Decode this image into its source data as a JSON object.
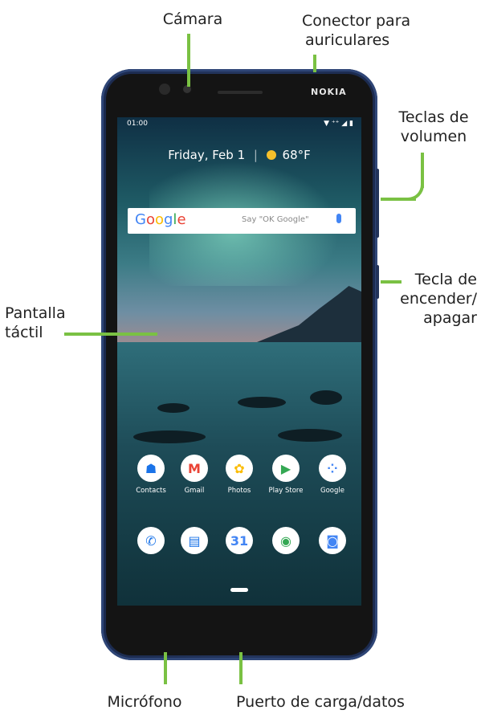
{
  "labels": {
    "camera": "Cámara",
    "headphone_jack_line1": "Conector para",
    "headphone_jack_line2": "auriculares",
    "volume_line1": "Teclas de",
    "volume_line2": "volumen",
    "power_line1": "Tecla de",
    "power_line2": "encender/",
    "power_line3": "apagar",
    "touchscreen_line1": "Pantalla",
    "touchscreen_line2": "táctil",
    "microphone": "Micrófono",
    "charging_port": "Puerto de carga/datos"
  },
  "phone": {
    "brand": "NOKIA",
    "status_time": "01:00",
    "status_icons": "▼ ⁺⁺ ◢ ▮",
    "date_text": "Friday, Feb 1",
    "separator": "|",
    "temperature": "68°F",
    "search_hint": "Say \"OK Google\"",
    "google_logo": "Google",
    "apps": [
      {
        "label": "Contacts",
        "icon": "contacts-icon",
        "glyph": "☗",
        "color": "#1a73e8"
      },
      {
        "label": "Gmail",
        "icon": "gmail-icon",
        "glyph": "M",
        "color": "#ea4335"
      },
      {
        "label": "Photos",
        "icon": "photos-icon",
        "glyph": "✿",
        "color": "#fbbc04"
      },
      {
        "label": "Play Store",
        "icon": "play-store-icon",
        "glyph": "▶",
        "color": "#34a853"
      },
      {
        "label": "Google",
        "icon": "google-folder-icon",
        "glyph": "⁘",
        "color": "#4285f4"
      }
    ],
    "dock": [
      {
        "icon": "phone-icon",
        "glyph": "✆",
        "color": "#1a73e8"
      },
      {
        "icon": "messages-icon",
        "glyph": "▤",
        "color": "#1a73e8"
      },
      {
        "icon": "calendar-icon",
        "glyph": "31",
        "color": "#4285f4"
      },
      {
        "icon": "chrome-icon",
        "glyph": "◉",
        "color": "#34a853"
      },
      {
        "icon": "camera-app-icon",
        "glyph": "◙",
        "color": "#4285f4"
      }
    ]
  },
  "colors": {
    "callout_line": "#7ac143",
    "phone_body": "#1b2a4e"
  }
}
